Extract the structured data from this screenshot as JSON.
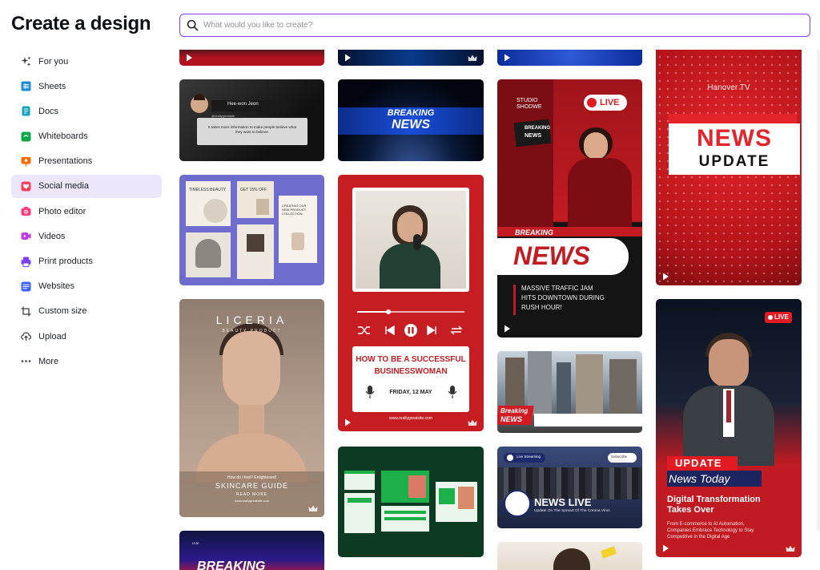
{
  "page": {
    "title": "Create a design"
  },
  "search": {
    "placeholder": "What would you like to create?"
  },
  "sidebar": {
    "items": [
      {
        "label": "For you",
        "icon": "sparkle-icon",
        "color": "#3c4044"
      },
      {
        "label": "Sheets",
        "icon": "sheets-icon",
        "color": "#1f8bde"
      },
      {
        "label": "Docs",
        "icon": "docs-icon",
        "color": "#12a5c2"
      },
      {
        "label": "Whiteboards",
        "icon": "whiteboards-icon",
        "color": "#0ba84a"
      },
      {
        "label": "Presentations",
        "icon": "presentations-icon",
        "color": "#ff6a00"
      },
      {
        "label": "Social media",
        "icon": "heart-icon",
        "color": "#ff3b5c",
        "active": true
      },
      {
        "label": "Photo editor",
        "icon": "camera-icon",
        "color": "#ff3b7a"
      },
      {
        "label": "Videos",
        "icon": "video-icon",
        "color": "#c239e8"
      },
      {
        "label": "Print products",
        "icon": "printer-icon",
        "color": "#7b3dff"
      },
      {
        "label": "Websites",
        "icon": "globe-icon",
        "color": "#3d63ff"
      },
      {
        "label": "Custom size",
        "icon": "crop-icon",
        "color": "#3c4044"
      },
      {
        "label": "Upload",
        "icon": "upload-cloud-icon",
        "color": "#3c4044"
      },
      {
        "label": "More",
        "icon": "more-icon",
        "color": "#3c4044"
      }
    ]
  },
  "templates": {
    "t1": {
      "name": "Hee-won Jeon",
      "handle": "@reallygreatsite",
      "quote": "It takes more information to make people believe what they want to believe."
    },
    "t2": {
      "line1": "BREAKING",
      "line2": "NEWS"
    },
    "t3": {
      "a": "TIMELESS BEAUTY",
      "b": "GET 15% OFF",
      "c": "CREATING OUR NEW PRODUCT COLLECTION"
    },
    "t4": {
      "brand": "LICERIA",
      "sub": "BEAUTY PRODUCT",
      "q": "How do I feel? Enlightened!",
      "guide": "SKINCARE GUIDE",
      "more": "READ MORE",
      "site": "www.reallygreatsite.com"
    },
    "t5": {
      "h1": "HOW TO BE A SUCCESSFUL",
      "h2": "BUSINESSWOMAN",
      "date": "FRIDAY, 12 MAY",
      "site": "www.reallygreatsite.com"
    },
    "t6": {
      "studio1": "STUDIO",
      "studio2": "SHODWE",
      "live": "LIVE",
      "mic1": "BREAKING",
      "mic2": "NEWS",
      "breaking": "BREAKING",
      "news": "NEWS",
      "body1": "MASSIVE TRAFFIC JAM",
      "body2": "HITS DOWNTOWN DURING",
      "body3": "RUSH HOUR!"
    },
    "t7": {
      "channel": "Hanover TV",
      "news": "NEWS",
      "update": "UPDATE"
    },
    "t8": {
      "breaking": "Breaking",
      "news": "NEWS"
    },
    "t9": {
      "news": "NEWS LIVE",
      "sub": "Update On The Spread Of The Corona Virus",
      "tag": "Live Streaming",
      "sub2": "Subscribe"
    },
    "t10": {
      "live": "LIVE",
      "update": "UPDATE",
      "today": "News Today",
      "h1": "Digital Transformation",
      "h2": "Takes Over",
      "b1": "From E-commerce to AI Automation,",
      "b2": "Companies Embrace Technology to Stay",
      "b3": "Competitive in the Digital Age"
    },
    "t11": {
      "text": "BREAKING",
      "live": "LIVE"
    }
  }
}
